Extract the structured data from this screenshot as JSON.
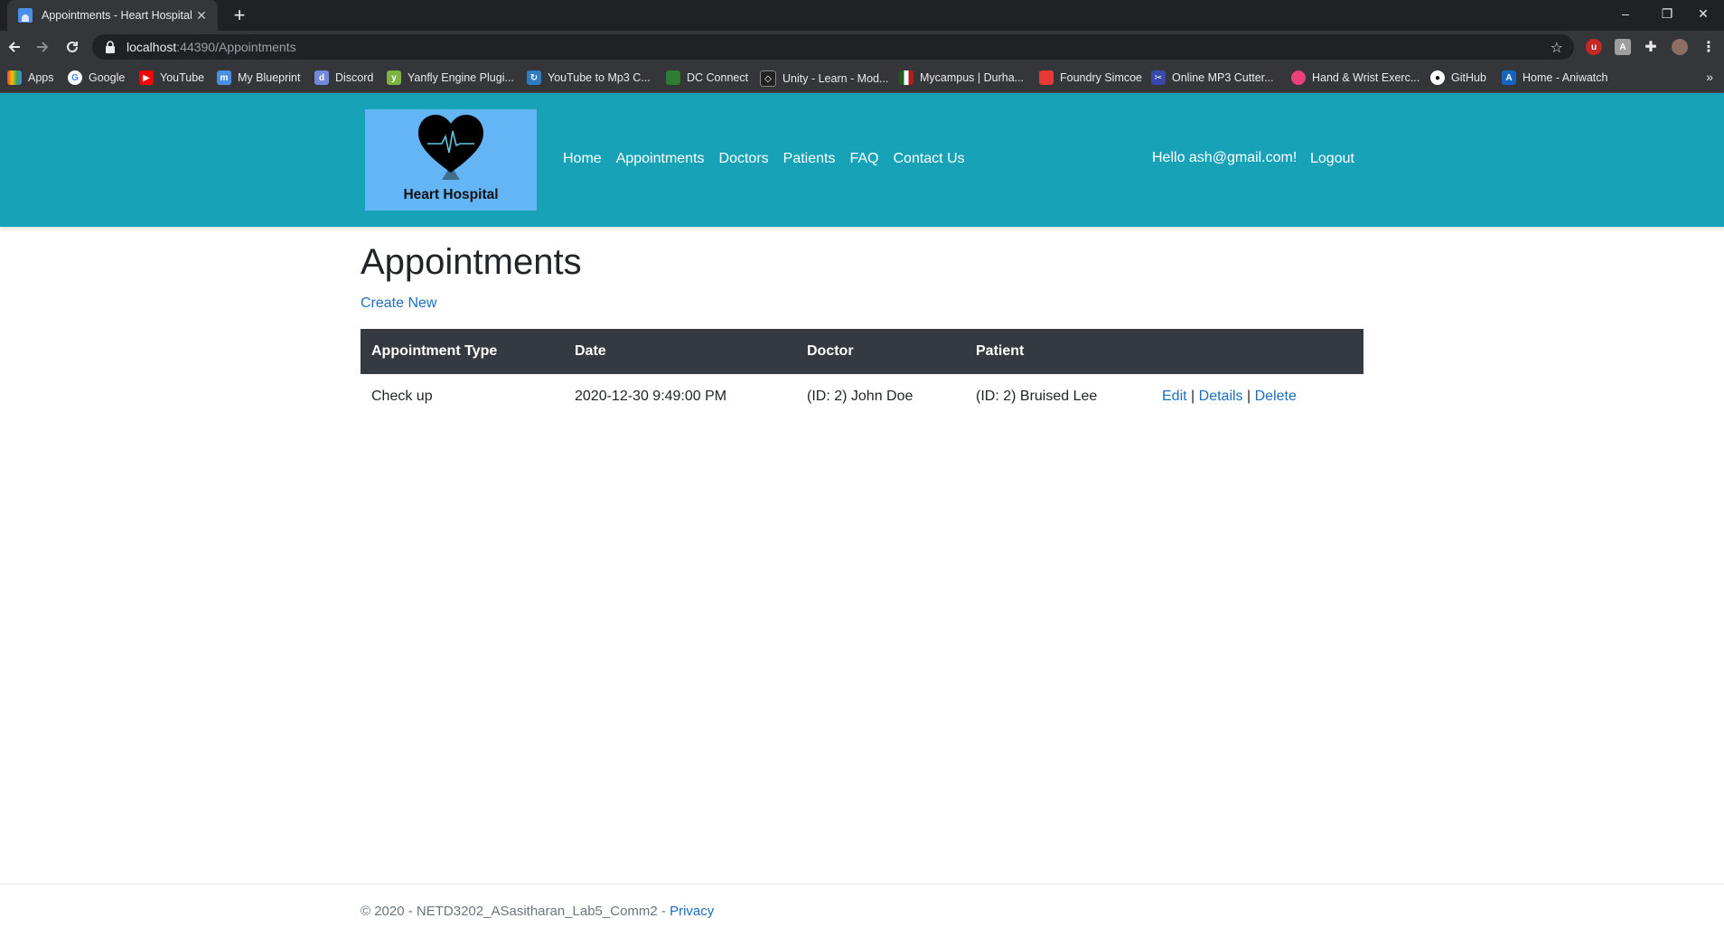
{
  "browser": {
    "tab_title": "Appointments - Heart Hospital",
    "url_host": "localhost",
    "url_path": ":44390/Appointments",
    "new_tab_symbol": "+",
    "tab_close_symbol": "✕",
    "window_controls": [
      "–",
      "❐",
      "✕"
    ]
  },
  "bookmarks": [
    {
      "label": "Apps",
      "icon": "apps-grid-icon",
      "color": "#ea4335"
    },
    {
      "label": "Google",
      "icon": "google-icon",
      "color": "#ffffff"
    },
    {
      "label": "YouTube",
      "icon": "youtube-icon",
      "color": "#ff0000"
    },
    {
      "label": "My Blueprint",
      "icon": "blueprint-icon",
      "color": "#4a90e2"
    },
    {
      "label": "Discord",
      "icon": "discord-icon",
      "color": "#7289da"
    },
    {
      "label": "Yanfly Engine Plugi...",
      "icon": "yanfly-icon",
      "color": "#7cb342"
    },
    {
      "label": "YouTube to Mp3 C...",
      "icon": "converter-icon",
      "color": "#2f7cc1"
    },
    {
      "label": "DC Connect",
      "icon": "dc-connect-icon",
      "color": "#2e7d32"
    },
    {
      "label": "Unity - Learn - Mod...",
      "icon": "unity-icon",
      "color": "#222222"
    },
    {
      "label": "Mycampus | Durha...",
      "icon": "mycampus-icon",
      "color": "#1b5e20"
    },
    {
      "label": "Foundry Simcoe",
      "icon": "foundry-icon",
      "color": "#e53935"
    },
    {
      "label": "Online MP3 Cutter...",
      "icon": "mp3-cutter-icon",
      "color": "#3949ab"
    },
    {
      "label": "Hand & Wrist Exerc...",
      "icon": "exercise-icon",
      "color": "#ec407a"
    },
    {
      "label": "GitHub",
      "icon": "github-icon",
      "color": "#ffffff"
    },
    {
      "label": "Home - Aniwatch",
      "icon": "aniwatch-icon",
      "color": "#1565c0"
    }
  ],
  "site": {
    "logo_text": "Heart Hospital",
    "nav": [
      "Home",
      "Appointments",
      "Doctors",
      "Patients",
      "FAQ",
      "Contact Us"
    ],
    "greeting": "Hello ash@gmail.com!",
    "logout_label": "Logout",
    "header_color": "#17a2b8"
  },
  "main": {
    "title": "Appointments",
    "create_new_label": "Create New",
    "table": {
      "headers": [
        "Appointment Type",
        "Date",
        "Doctor",
        "Patient"
      ],
      "rows": [
        {
          "type": "Check up",
          "date": "2020-12-30 9:49:00 PM",
          "doctor": "(ID: 2) John Doe",
          "patient": "(ID: 2) Bruised Lee",
          "actions": {
            "edit": "Edit",
            "details": "Details",
            "delete": "Delete",
            "separator": "|"
          }
        }
      ]
    }
  },
  "footer": {
    "text": "© 2020 - NETD3202_ASasitharan_Lab5_Comm2 - ",
    "privacy_label": "Privacy"
  }
}
